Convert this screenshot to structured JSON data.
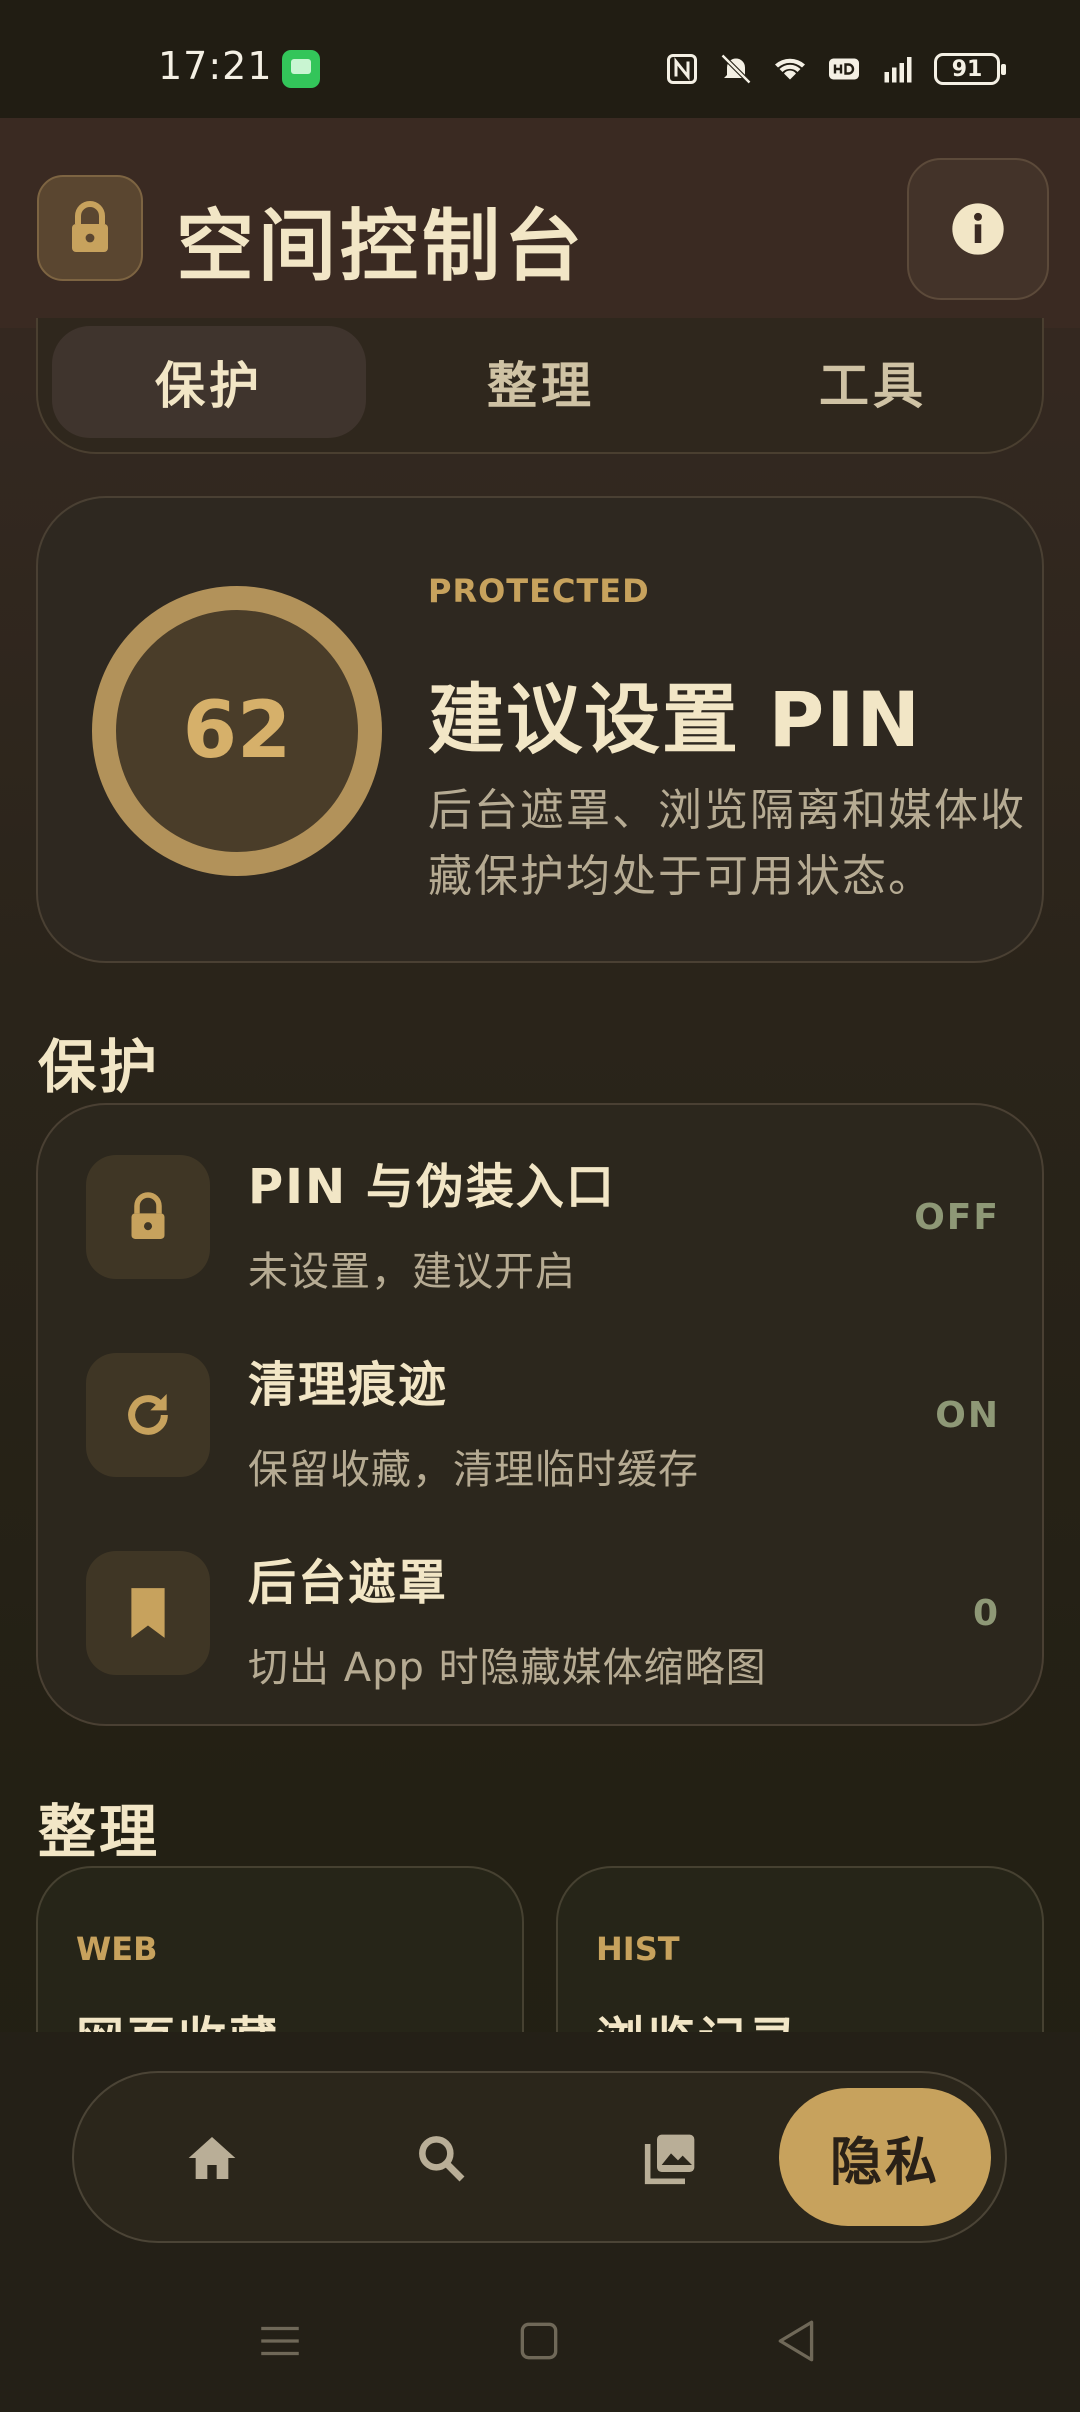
{
  "status_bar": {
    "time": "17:21",
    "battery": "91",
    "icons": [
      "chat-notification-icon",
      "nfc-icon",
      "mute-bell-icon",
      "wifi-icon",
      "hd-icon",
      "5g-signal-icon",
      "battery-icon"
    ]
  },
  "header": {
    "title": "空间控制台",
    "lock_icon": "lock-icon",
    "info_icon": "info-icon"
  },
  "tabs": [
    {
      "label": "保护",
      "active": true
    },
    {
      "label": "整理",
      "active": false
    },
    {
      "label": "工具",
      "active": false
    }
  ],
  "score_card": {
    "score": "62",
    "badge": "PROTECTED",
    "title": "建议设置 PIN",
    "description": "后台遮罩、浏览隔离和媒体收藏保护均处于可用状态。"
  },
  "protection": {
    "section_title": "保护",
    "rows": [
      {
        "title": "PIN 与伪装入口",
        "subtitle": "未设置，建议开启",
        "value": "OFF",
        "icon": "lock-icon"
      },
      {
        "title": "清理痕迹",
        "subtitle": "保留收藏，清理临时缓存",
        "value": "ON",
        "icon": "refresh-icon"
      },
      {
        "title": "后台遮罩",
        "subtitle": "切出 App 时隐藏媒体缩略图",
        "value": "0",
        "icon": "bookmark-icon"
      }
    ]
  },
  "organize": {
    "section_title": "整理",
    "cards": [
      {
        "tag": "WEB",
        "title": "网页收藏"
      },
      {
        "tag": "HIST",
        "title": "浏览记录"
      }
    ]
  },
  "bottom_nav": {
    "items": [
      "home-icon",
      "search-icon",
      "gallery-icon"
    ],
    "active_label": "隐私"
  },
  "colors": {
    "accent": "#c7a25d",
    "background": "#2a241a",
    "text_primary": "#f2e6c6",
    "text_secondary": "#b6ab93",
    "status_value": "#8e9876"
  }
}
